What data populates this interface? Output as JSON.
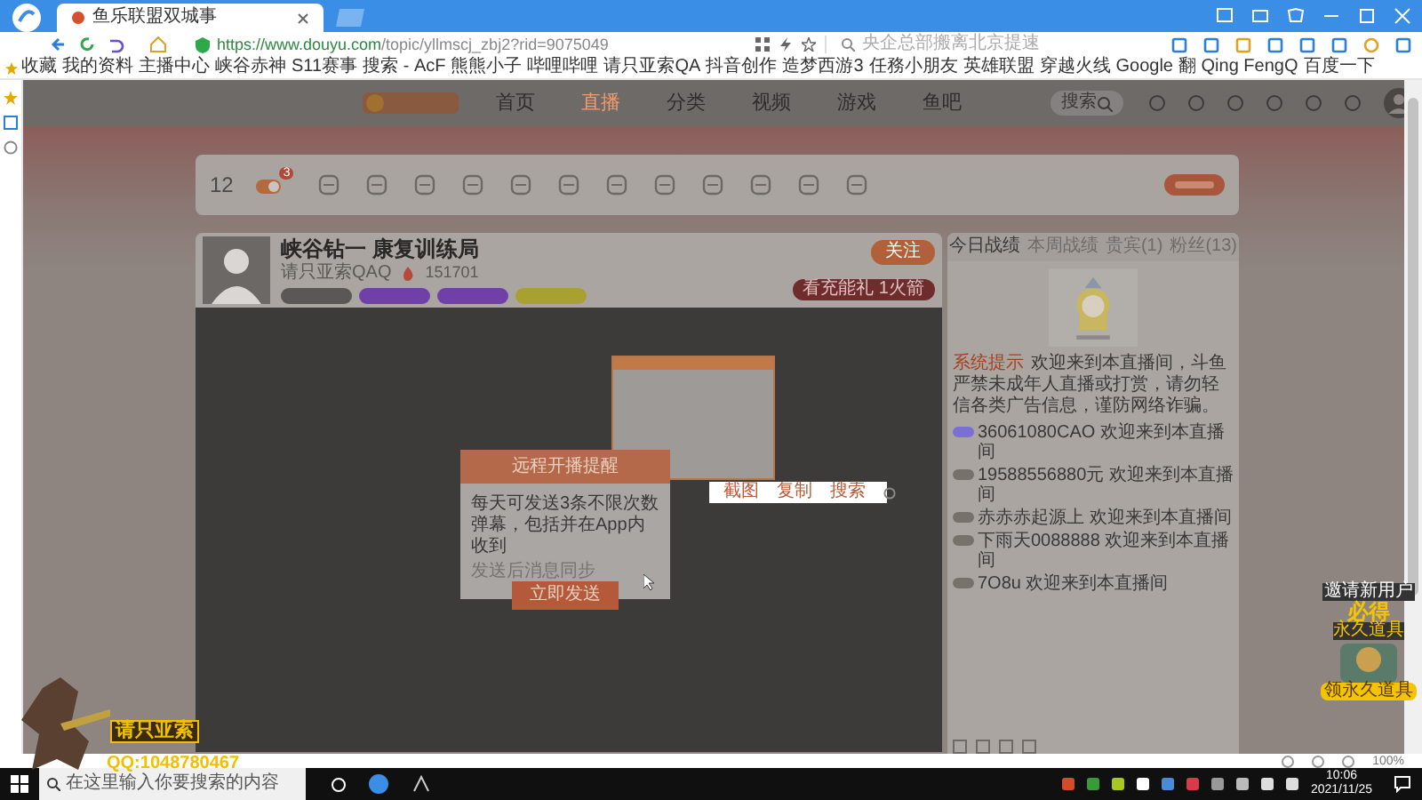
{
  "browser": {
    "tab_title": "鱼乐联盟双城事",
    "url_host": "https://www.douyu.com",
    "url_path": "/topic/yllmscj_zbj2?rid=9075049",
    "address_hint": "央企总部搬离北京提速",
    "zoom": "100%",
    "bookmarks": [
      "收藏",
      "我的资料",
      "主播中心",
      "峡谷赤神",
      "S11赛事",
      "搜索 - AcF",
      "熊熊小子",
      "哔哩哔哩",
      "请只亚索QA",
      "抖音创作",
      "造梦西游3",
      "任務小朋友",
      "英雄联盟",
      "穿越火线",
      "Google 翻",
      "Qing FengQ",
      "百度一下"
    ]
  },
  "site_nav": {
    "items": [
      {
        "label": "首页",
        "selected": false
      },
      {
        "label": "直播",
        "selected": true
      },
      {
        "label": "分类",
        "selected": false
      },
      {
        "label": "视频",
        "selected": false
      },
      {
        "label": "游戏",
        "selected": false
      },
      {
        "label": "鱼吧",
        "selected": false
      }
    ],
    "search_placeholder": "搜索"
  },
  "feature_bar": {
    "count": "12",
    "badge": "3"
  },
  "room": {
    "title": "峡谷钻一 康复训练局",
    "host": "请只亚索QAQ",
    "heat": "151701",
    "follow": "关注",
    "gift": "看充能礼 1火箭"
  },
  "chat": {
    "tabs": [
      {
        "label": "今日战绩",
        "selected": true
      },
      {
        "label": "本周战绩",
        "selected": false
      },
      {
        "label": "贵宾(1)",
        "selected": false
      },
      {
        "label": "粉丝(13)",
        "selected": false
      }
    ],
    "system_label": "系统提示",
    "system_message": "欢迎来到本直播间，斗鱼严禁未成年人直播或打赏，请勿轻信各类广告信息，谨防网络诈骗。",
    "messages": [
      {
        "user": "36061080CAO",
        "text": "欢迎来到本直播间",
        "color": "#7b6fd6"
      },
      {
        "user": "19588556880元",
        "text": "欢迎来到本直播间",
        "color": "#77716c"
      },
      {
        "user": "赤赤赤起源上",
        "text": "欢迎来到本直播间",
        "color": "#77716c"
      },
      {
        "user": "下雨天0088888",
        "text": "欢迎来到本直播间",
        "color": "#77716c"
      },
      {
        "user": "7O8u",
        "text": "欢迎来到本直播间",
        "color": "#77716c"
      }
    ]
  },
  "dialog": {
    "title": "远程开播提醒",
    "message": "每天可发送3条不限次数弹幕，包括并在App内收到",
    "note": "发送后消息同步",
    "button": "立即发送"
  },
  "context_menu": {
    "items": [
      "截图",
      "复制",
      "搜索"
    ]
  },
  "ad": {
    "line1": "邀请新用户",
    "line2": "必得",
    "line3": "永久道具",
    "button": "领永久道具"
  },
  "overlay": {
    "title": "请只亚索",
    "qq": "QQ:1048780467"
  },
  "taskbar": {
    "search_placeholder": "在这里输入你要搜索的内容",
    "time": "10:06",
    "date": "2021/11/25"
  }
}
